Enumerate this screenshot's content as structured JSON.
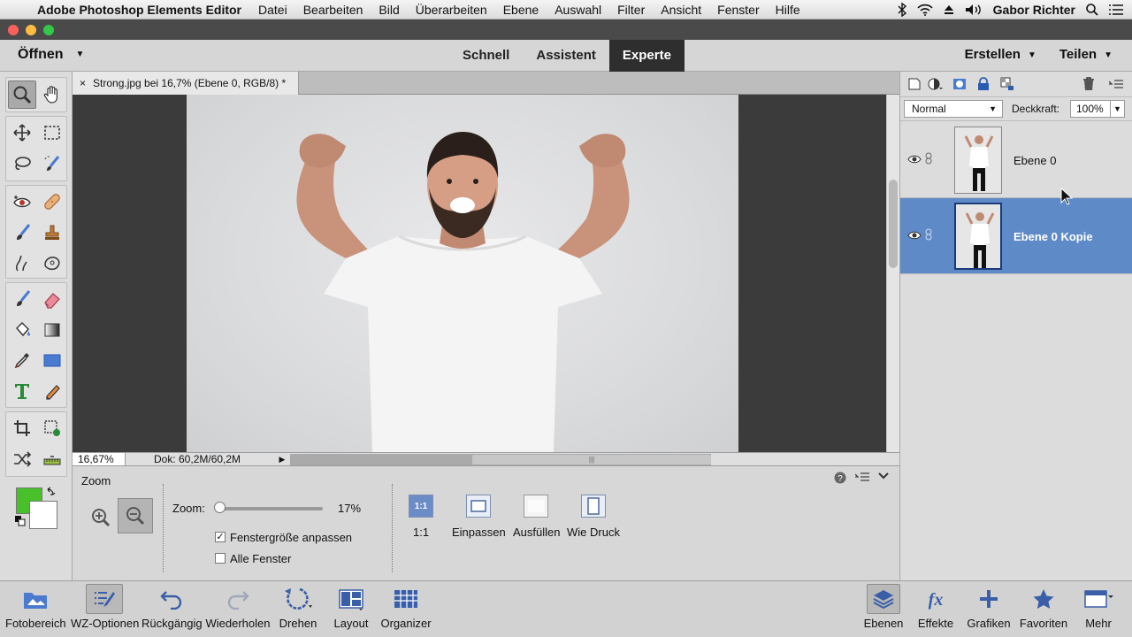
{
  "menubar": {
    "app_name": "Adobe Photoshop Elements Editor",
    "items": [
      "Datei",
      "Bearbeiten",
      "Bild",
      "Überarbeiten",
      "Ebene",
      "Auswahl",
      "Filter",
      "Ansicht",
      "Fenster",
      "Hilfe"
    ],
    "user": "Gabor Richter"
  },
  "modebar": {
    "open_label": "Öffnen",
    "tabs": [
      "Schnell",
      "Assistent",
      "Experte"
    ],
    "active_tab": "Experte",
    "create_label": "Erstellen",
    "share_label": "Teilen"
  },
  "document": {
    "tab_title": "Strong.jpg bei 16,7% (Ebene 0, RGB/8) *",
    "close_glyph": "×",
    "zoom_field": "16,67%",
    "doc_info": "Dok: 60,2M/60,2M"
  },
  "colors": {
    "foreground": "#48c02a",
    "background": "#ffffff",
    "accent": "#5f8ac8"
  },
  "options": {
    "title": "Zoom",
    "zoom_label": "Zoom:",
    "zoom_value": "17%",
    "zoom_slider_fraction": 0.0,
    "fit_window_label": "Fenstergröße anpassen",
    "fit_window_checked": true,
    "all_windows_label": "Alle Fenster",
    "all_windows_checked": false,
    "view_buttons": [
      "1:1",
      "Einpassen",
      "Ausfüllen",
      "Wie Druck"
    ],
    "btn_1_1_text": "1:1"
  },
  "layers": {
    "blend_mode": "Normal",
    "opacity_label": "Deckkraft:",
    "opacity_value": "100%",
    "items": [
      {
        "name": "Ebene 0",
        "selected": false
      },
      {
        "name": "Ebene 0 Kopie",
        "selected": true
      }
    ]
  },
  "taskbar": {
    "items": [
      "Fotobereich",
      "WZ-Optionen",
      "Rückgängig",
      "Wiederholen",
      "Drehen",
      "Layout",
      "Organizer"
    ],
    "right_items": [
      "Ebenen",
      "Effekte",
      "Grafiken",
      "Favoriten",
      "Mehr"
    ]
  }
}
